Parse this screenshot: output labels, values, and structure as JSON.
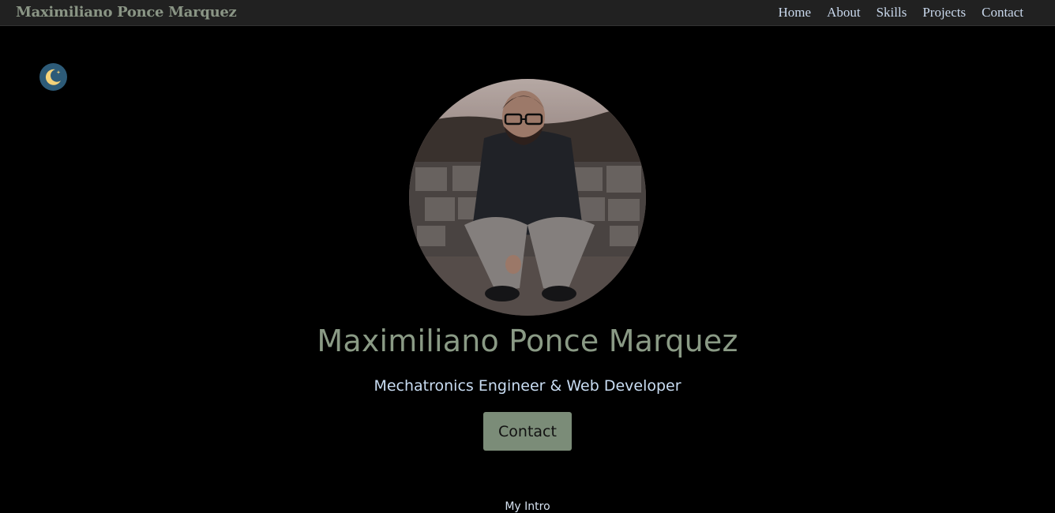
{
  "navbar": {
    "brand": "Maximiliano Ponce Marquez",
    "links": [
      "Home",
      "About",
      "Skills",
      "Projects",
      "Contact"
    ]
  },
  "theme_toggle": {
    "icon": "moon-icon"
  },
  "hero": {
    "name": "Maximiliano Ponce Marquez",
    "tagline": "Mechatronics Engineer & Web Developer",
    "cta_label": "Contact"
  },
  "intro": {
    "label": "My Intro"
  },
  "colors": {
    "navbar_bg": "#212121",
    "brand": "#8a9585",
    "nav_link": "#c9d8ec",
    "name": "#8a9a85",
    "tagline": "#c9ddf3",
    "cta_bg": "#7b8c78",
    "toggle_bg": "#2d5b78",
    "moon": "#f5d37a"
  }
}
